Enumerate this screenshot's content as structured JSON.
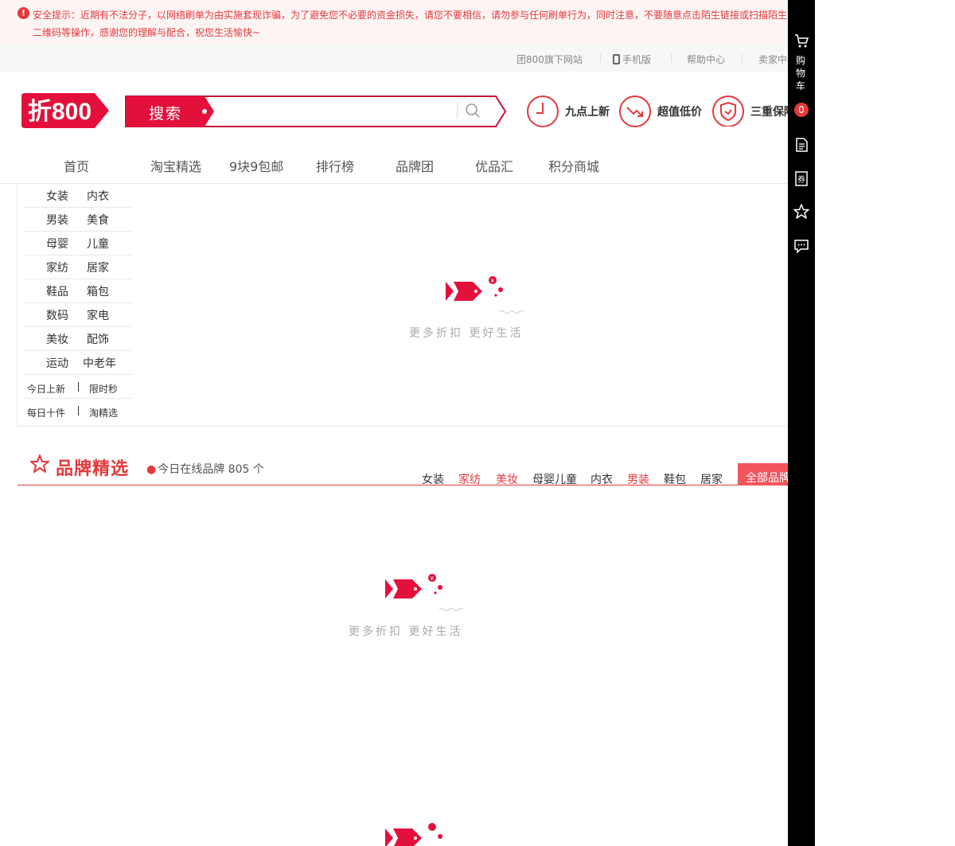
{
  "notice": {
    "icon": "warning-icon",
    "text": "安全提示：近期有不法分子，以网络刷单为由实施套现诈骗，为了避免您不必要的资金损失，请您不要相信，请勿参与任何刷单行为，同时注意，不要随意点击陌生链接或扫描陌生二维码等操作，感谢您的理解与配合，祝您生活愉快~"
  },
  "toplinks": {
    "tuan": "团800旗下网站",
    "mobile": "手机版",
    "help": "帮助中心",
    "seller": "卖家中心"
  },
  "header": {
    "logo": "折800",
    "search_label": "搜索",
    "search_placeholder": "",
    "features": [
      "九点上新",
      "超值低价",
      "三重保障"
    ]
  },
  "nav": [
    "首页",
    "淘宝精选",
    "9块9包邮",
    "排行榜",
    "品牌团",
    "优品汇",
    "积分商城"
  ],
  "categories": {
    "rows": [
      [
        "女装",
        "内衣"
      ],
      [
        "男装",
        "美食"
      ],
      [
        "母婴",
        "儿童"
      ],
      [
        "家纺",
        "居家"
      ],
      [
        "鞋品",
        "箱包"
      ],
      [
        "数码",
        "家电"
      ],
      [
        "美妆",
        "配饰"
      ],
      [
        "运动",
        "中老年"
      ]
    ],
    "small": [
      [
        "今日上新",
        "限时秒"
      ],
      [
        "每日十件",
        "淘精选"
      ]
    ]
  },
  "placeholder": {
    "slogan": "更多折扣 更好生活"
  },
  "brand": {
    "title": "品牌精选",
    "count_text": "今日在线品牌 805 个",
    "tabs": [
      {
        "label": "女装",
        "color": "#333333"
      },
      {
        "label": "家纺",
        "color": "#e4393c"
      },
      {
        "label": "美妆",
        "color": "#e4393c"
      },
      {
        "label": "母婴儿童",
        "color": "#333333"
      },
      {
        "label": "内衣",
        "color": "#333333"
      },
      {
        "label": "男装",
        "color": "#e4393c"
      },
      {
        "label": "鞋包",
        "color": "#333333"
      },
      {
        "label": "居家",
        "color": "#333333"
      }
    ],
    "all_label": "全部品牌"
  },
  "rightbar": {
    "cart_label": "购物车",
    "cart_count": "0",
    "icons": [
      "order-list-icon",
      "coupon-icon",
      "favorite-star-icon",
      "message-icon"
    ]
  },
  "colors": {
    "accent": "#e4393c",
    "logo": "#e4103c"
  }
}
